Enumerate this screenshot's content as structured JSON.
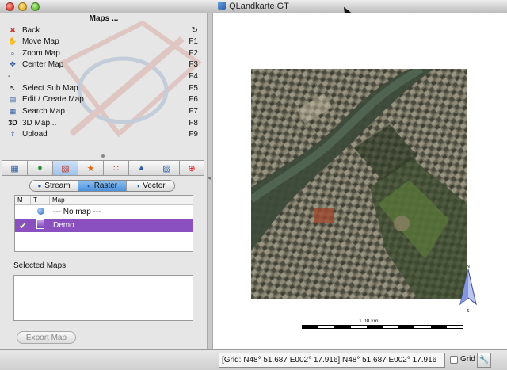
{
  "window": {
    "title": "QLandkarte GT"
  },
  "menu": {
    "title": "Maps ...",
    "items": [
      {
        "label": "Back",
        "key": "↻",
        "icon": "back-arrow-icon",
        "glyph": "✖"
      },
      {
        "label": "Move Map",
        "key": "F1",
        "icon": "move-hand-icon",
        "glyph": "✋"
      },
      {
        "label": "Zoom Map",
        "key": "F2",
        "icon": "zoom-icon",
        "glyph": "⌕"
      },
      {
        "label": "Center Map",
        "key": "F3",
        "icon": "center-icon",
        "glyph": "✥"
      },
      {
        "label": "-",
        "key": "F4",
        "icon": "none",
        "glyph": ""
      },
      {
        "label": "Select Sub Map",
        "key": "F5",
        "icon": "pointer-icon",
        "glyph": "↖"
      },
      {
        "label": "Edit / Create Map",
        "key": "F6",
        "icon": "edit-map-icon",
        "glyph": "▤"
      },
      {
        "label": "Search Map",
        "key": "F7",
        "icon": "search-map-icon",
        "glyph": "▦"
      },
      {
        "label": "3D Map...",
        "key": "F8",
        "icon": "3d-icon",
        "glyph": "3D"
      },
      {
        "label": "Upload",
        "key": "F9",
        "icon": "upload-icon",
        "glyph": "⇧"
      }
    ]
  },
  "toolbar": {
    "buttons": [
      {
        "icon": "map-list-icon",
        "glyph": "▦"
      },
      {
        "icon": "globe-icon",
        "glyph": "●"
      },
      {
        "icon": "map-active-icon",
        "glyph": "▧"
      },
      {
        "icon": "waypoint-star-icon",
        "glyph": "★"
      },
      {
        "icon": "track-icon",
        "glyph": "∷"
      },
      {
        "icon": "route-icon",
        "glyph": "▲"
      },
      {
        "icon": "overlay-icon",
        "glyph": "▨"
      },
      {
        "icon": "lifebuoy-icon",
        "glyph": "⊕"
      }
    ],
    "active_index": 2
  },
  "source_tabs": [
    {
      "label": "Stream",
      "active": false
    },
    {
      "label": "Raster",
      "active": true
    },
    {
      "label": "Vector",
      "active": false
    }
  ],
  "map_list": {
    "headers": [
      "M",
      "T",
      "Map"
    ],
    "rows": [
      {
        "check": "",
        "name": "--- No map ---",
        "selected": false
      },
      {
        "check": "✔",
        "name": "Demo",
        "selected": true
      }
    ]
  },
  "selected_maps": {
    "label": "Selected Maps:"
  },
  "export_button": {
    "label": "Export Map",
    "disabled": true
  },
  "map_view": {
    "scale_label": "1.00 km",
    "compass_n": "N",
    "compass_s": "S"
  },
  "status": {
    "coords": "[Grid: N48° 51.687 E002° 17.916] N48° 51.687 E002° 17.916",
    "grid_label": "Grid",
    "grid_checked": false
  },
  "colors": {
    "selection": "#8a50c0",
    "accent": "#4b92dd"
  }
}
